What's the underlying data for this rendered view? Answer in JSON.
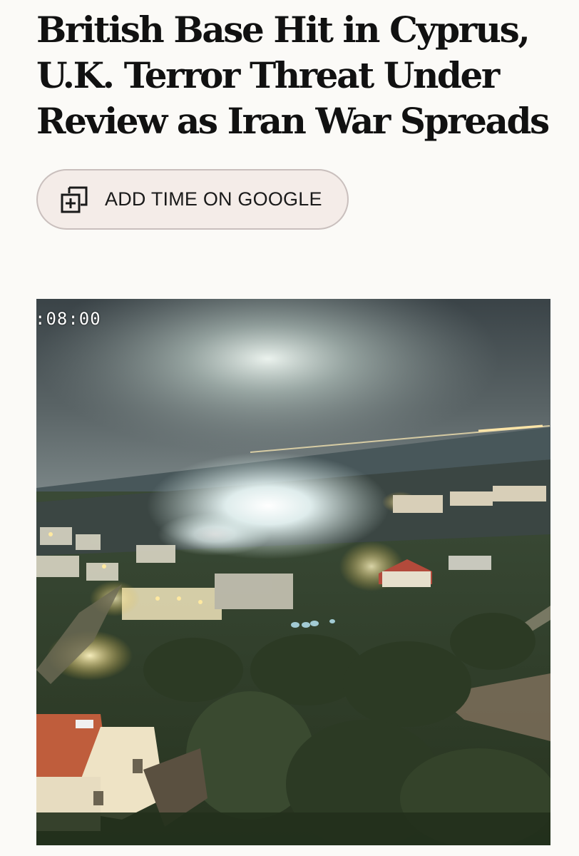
{
  "article": {
    "headline": "British Base Hit in Cyprus, U.K. Terror Threat Under Review as Iran War Spreads"
  },
  "add_button": {
    "icon": "add-to-stack-icon",
    "label": "ADD TIME ON GOOGLE"
  },
  "photo": {
    "timestamp": ":08:00"
  }
}
